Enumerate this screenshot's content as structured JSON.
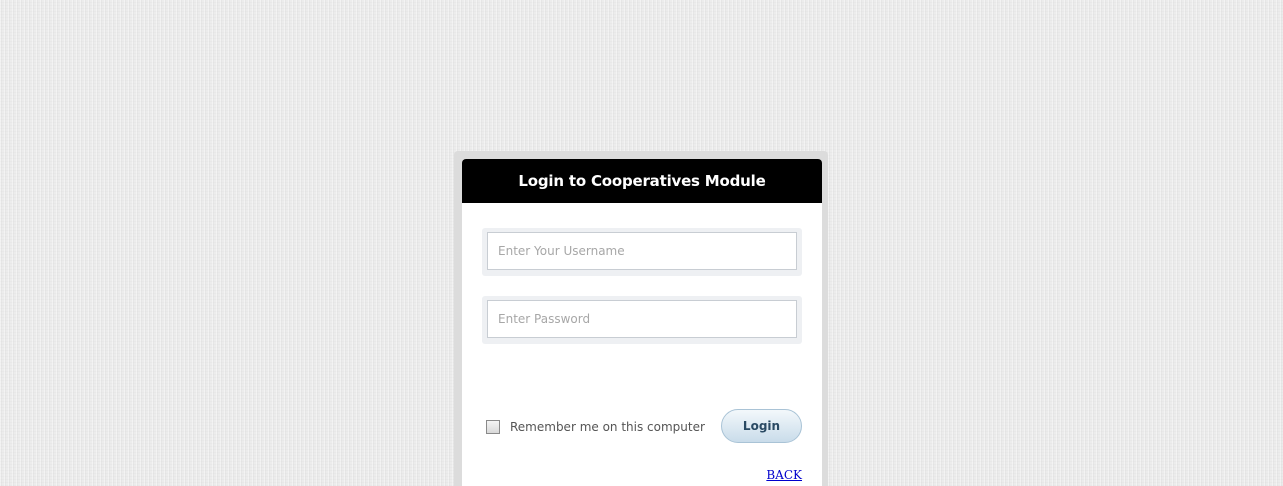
{
  "login_panel": {
    "title": "Login to Cooperatives Module",
    "username": {
      "value": "",
      "placeholder": "Enter Your Username"
    },
    "password": {
      "value": "",
      "placeholder": "Enter Password"
    },
    "remember_label": "Remember me on this computer",
    "remember_checked": false,
    "login_label": "Login",
    "back_label": "BACK"
  },
  "colors": {
    "header_bg": "#000000",
    "header_text": "#ffffff",
    "link": "#0000cc",
    "button_bg": "#c9dcea"
  }
}
